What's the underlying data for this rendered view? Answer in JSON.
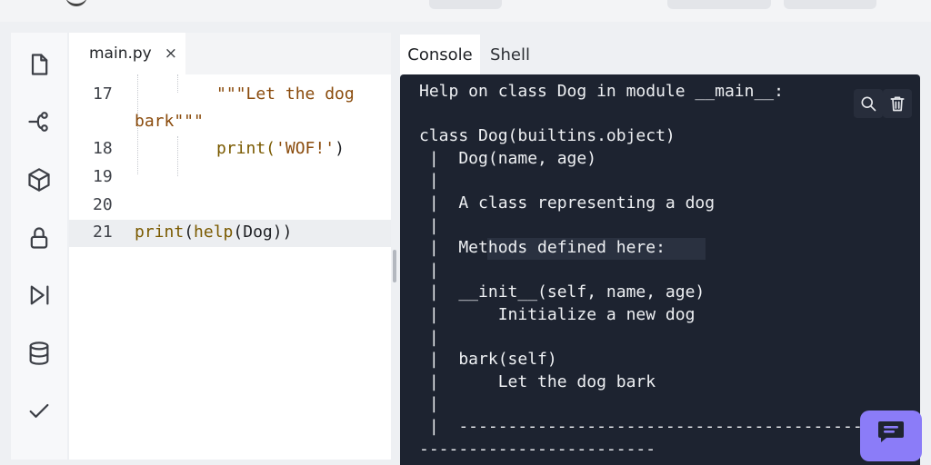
{
  "editor": {
    "tab": {
      "label": "main.py",
      "close_glyph": "×"
    },
    "partial_line_text": "\"\"\"",
    "lines": [
      {
        "number": "17",
        "segments": [
          {
            "text": "\"\"\"Let the dog",
            "kind": "string"
          }
        ]
      },
      {
        "number": "",
        "segments": [
          {
            "text": "bark\"\"\"",
            "kind": "string"
          }
        ]
      },
      {
        "number": "18",
        "segments": [
          {
            "text": "print(",
            "kind": "plain"
          },
          {
            "text": "'WOF!'",
            "kind": "string"
          },
          {
            "text": ")",
            "kind": "plain"
          }
        ]
      },
      {
        "number": "19",
        "segments": []
      },
      {
        "number": "20",
        "segments": []
      },
      {
        "number": "21",
        "segments": [
          {
            "text": "print",
            "kind": "func"
          },
          {
            "text": "(",
            "kind": "plain"
          },
          {
            "text": "help",
            "kind": "func"
          },
          {
            "text": "(Dog))",
            "kind": "plain"
          }
        ]
      }
    ]
  },
  "console_panel": {
    "tabs": [
      {
        "label": "Console",
        "active": true
      },
      {
        "label": "Shell",
        "active": false
      }
    ],
    "lines": [
      "Help on class Dog in module __main__:",
      "",
      "class Dog(builtins.object)",
      " |  Dog(name, age)",
      " |",
      " |  A class representing a dog",
      " |",
      " |  Methods defined here:",
      " |",
      " |  __init__(self, name, age)",
      " |      Initialize a new dog",
      " |",
      " |  bark(self)",
      " |      Let the dog bark",
      " |",
      " |  ----------------------------------------------------------------",
      "------------------------"
    ]
  },
  "icons": {
    "sidebar": [
      "file-icon",
      "git-branch-icon",
      "package-icon",
      "lock-icon",
      "run-step-icon",
      "database-icon",
      "check-icon"
    ],
    "console_tools": [
      "search-icon",
      "trash-icon"
    ],
    "chat": "chat-icon"
  },
  "colors": {
    "console_bg": "#1d2330",
    "string": "#8a4b0c",
    "function": "#7a5a00",
    "chat_button": "#8b7cf8"
  }
}
